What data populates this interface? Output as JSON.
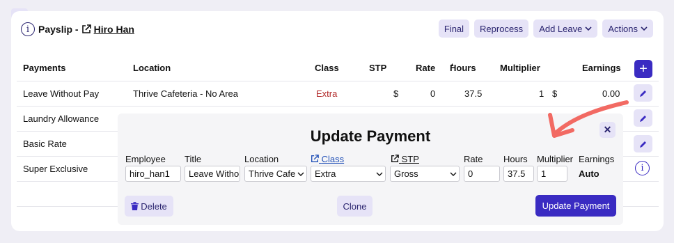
{
  "header": {
    "title_prefix": "Payslip -",
    "person": "Hiro Han",
    "buttons": {
      "final": "Final",
      "reprocess": "Reprocess",
      "add_leave": "Add Leave",
      "actions": "Actions"
    }
  },
  "table": {
    "columns": [
      "Payments",
      "Location",
      "Class",
      "STP",
      "Rate",
      "Hours",
      "Multiplier",
      "Earnings"
    ],
    "sort_indicator": "▲",
    "rows": [
      {
        "payment": "Leave Without Pay",
        "location": "Thrive Cafeteria - No Area",
        "class": "Extra",
        "stp_symbol": "$",
        "rate": "0",
        "hours": "37.5",
        "multiplier": "1",
        "earnings_symbol": "$",
        "earnings": "0.00"
      },
      {
        "payment": "Laundry Allowance"
      },
      {
        "payment": "Basic Rate"
      },
      {
        "payment": "Super Exclusive"
      }
    ],
    "colors": {
      "class_extra": "#b22a2a",
      "accent": "#3a2bc2"
    }
  },
  "modal": {
    "title": "Update Payment",
    "labels": {
      "employee": "Employee",
      "title": "Title",
      "location": "Location",
      "class": "Class",
      "stp": "STP",
      "rate": "Rate",
      "hours": "Hours",
      "multiplier": "Multiplier",
      "earnings": "Earnings"
    },
    "values": {
      "employee": "hiro_han1",
      "title": "Leave Witho",
      "location": "Thrive Cafe",
      "class": "Extra",
      "stp": "Gross",
      "rate": "0",
      "hours": "37.5",
      "multiplier": "1",
      "earnings": "Auto"
    },
    "buttons": {
      "delete": "Delete",
      "clone": "Clone",
      "update": "Update Payment"
    }
  }
}
